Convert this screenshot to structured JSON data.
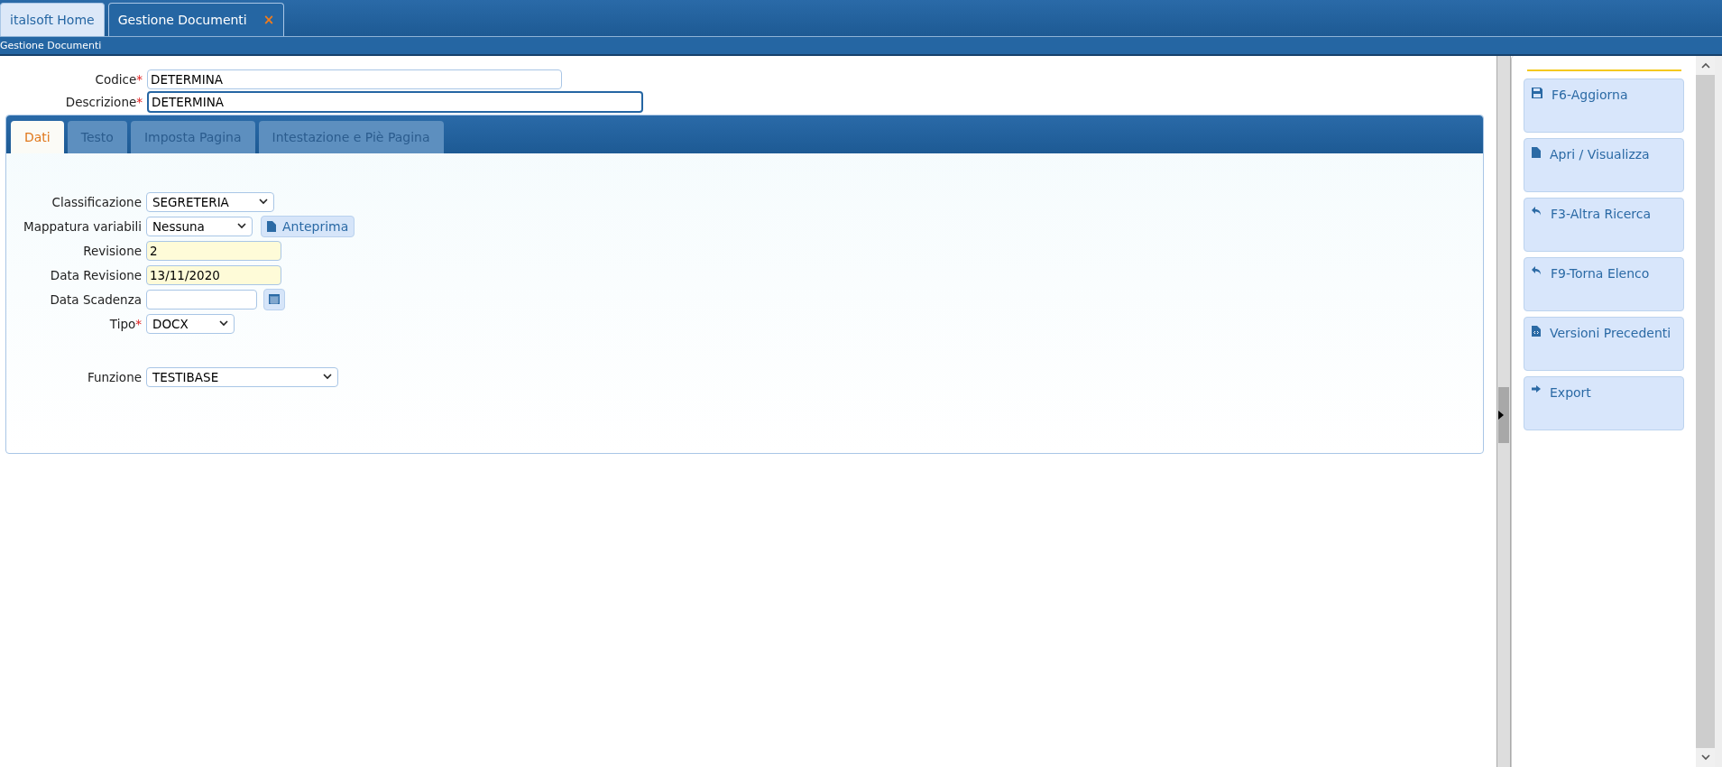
{
  "app_tabs": [
    {
      "label": "italsoft Home",
      "selected": false
    },
    {
      "label": "Gestione Documenti",
      "selected": true,
      "close": "×"
    }
  ],
  "breadcrumb": "Gestione Documenti",
  "header_fields": [
    {
      "label": "Codice",
      "mark": "*",
      "value": "DETERMINA",
      "focused": false
    },
    {
      "label": "Descrizione",
      "mark": "*",
      "value": "DETERMINA",
      "focused": true
    }
  ],
  "form_tabs": [
    {
      "label": "Dati",
      "selected": true
    },
    {
      "label": "Testo",
      "selected": false
    },
    {
      "label": "Imposta Pagina",
      "selected": false
    },
    {
      "label": "Intestazione e Piè Pagina",
      "selected": false
    }
  ],
  "fields": [
    {
      "kind": "select",
      "label": "Classificazione",
      "value": "SEGRETERIA"
    },
    {
      "kind": "select",
      "label": "Mappatura variabili",
      "value": "Nessuna",
      "button": "Anteprima"
    },
    {
      "kind": "text",
      "label": "Revisione",
      "value": "2",
      "readonly": true
    },
    {
      "kind": "text",
      "label": "Data Revisione",
      "value": "13/11/2020",
      "readonly": true
    },
    {
      "kind": "date",
      "label": "Data Scadenza",
      "readonly": false
    },
    {
      "kind": "select",
      "label": "Tipo",
      "mark": "*",
      "value": "DOCX"
    },
    {
      "kind": "spacer"
    },
    {
      "kind": "select",
      "label": "Funzione",
      "value": "TESTIBASE"
    }
  ],
  "actions": [
    {
      "label": "F6-Aggiorna"
    },
    {
      "label": "Apri / Visualizza"
    },
    {
      "label": "F3-Altra Ricerca"
    },
    {
      "label": "F9-Torna Elenco"
    },
    {
      "label": "Versioni Precedenti"
    },
    {
      "label": "Export"
    }
  ]
}
